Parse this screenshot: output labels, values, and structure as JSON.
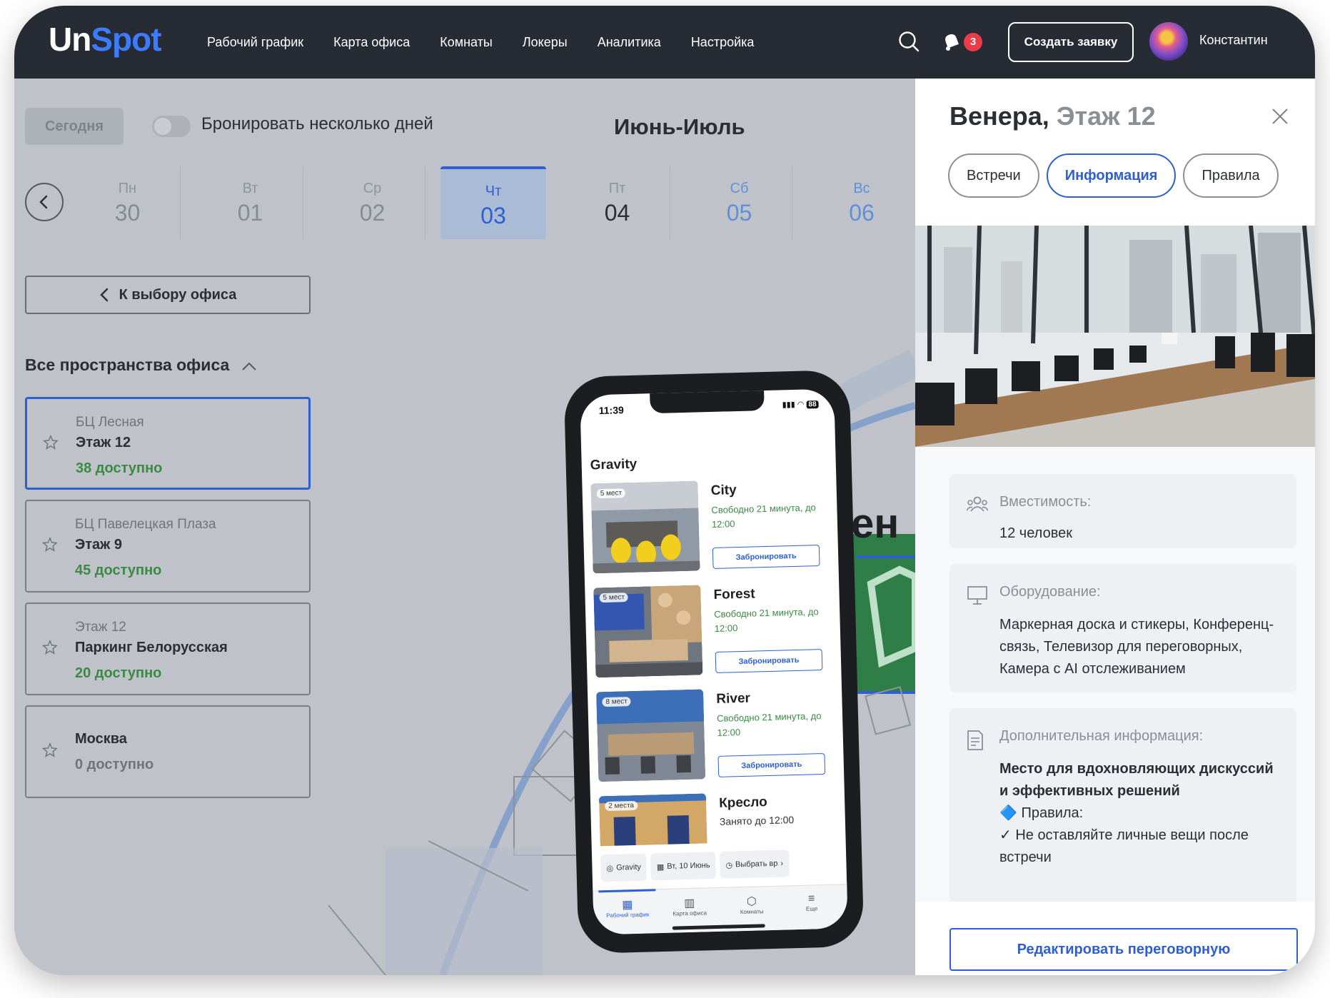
{
  "header": {
    "logo_un": "Un",
    "logo_spot": "Spot",
    "nav": [
      "Рабочий график",
      "Карта офиса",
      "Комнаты",
      "Локеры",
      "Аналитика",
      "Настройка"
    ],
    "notifications_count": "3",
    "create_button": "Создать заявку",
    "user_name": "Константин"
  },
  "calendar": {
    "today_button": "Сегодня",
    "multi_day_label": "Бронировать несколько дней",
    "multi_day_enabled": false,
    "month_label": "Июнь-Июль",
    "days": [
      {
        "name": "Пн",
        "date": "30"
      },
      {
        "name": "Вт",
        "date": "01"
      },
      {
        "name": "Ср",
        "date": "02"
      },
      {
        "name": "Чт",
        "date": "03"
      },
      {
        "name": "Пт",
        "date": "04"
      },
      {
        "name": "Сб",
        "date": "05"
      },
      {
        "name": "Вс",
        "date": "06"
      }
    ],
    "selected_day": "03"
  },
  "sidebar": {
    "back_button": "К выбору офиса",
    "section_title": "Все пространства офиса",
    "offices": [
      {
        "building": "БЦ Лесная",
        "floor": "Этаж 12",
        "available": "38 доступно"
      },
      {
        "building": "БЦ Павелецкая Плаза",
        "floor": "Этаж 9",
        "available": "45 доступно"
      },
      {
        "building": "Этаж 12",
        "floor": "Паркинг Белорусская",
        "available": "20 доступно"
      },
      {
        "building": "",
        "floor": "Москва",
        "available": "0 доступно"
      }
    ]
  },
  "map": {
    "room_label_fragment": "ен"
  },
  "phone": {
    "time": "11:39",
    "battery": "88",
    "section_title": "Gravity",
    "rooms": [
      {
        "name": "City",
        "capacity": "5 мест",
        "status": "Свободно 21 минута, до 12:00",
        "action": "Забронировать"
      },
      {
        "name": "Forest",
        "capacity": "5 мест",
        "status": "Свободно 21 минута, до 12:00",
        "action": "Забронировать"
      },
      {
        "name": "River",
        "capacity": "8 мест",
        "status": "Свободно 21 минута, до 12:00",
        "action": "Забронировать"
      },
      {
        "name": "Кресло",
        "capacity": "2 места",
        "status": "Занято до 12:00",
        "action": ""
      }
    ],
    "filters": [
      "Gravity",
      "Вт, 10 Июнь",
      "Выбрать вр"
    ],
    "tabs": [
      "Рабочий график",
      "Карта офиса",
      "Комнаты",
      "Еще"
    ]
  },
  "panel": {
    "title_room": "Венера,",
    "title_floor": "Этаж 12",
    "tabs": [
      "Встречи",
      "Информация",
      "Правила"
    ],
    "active_tab": "Информация",
    "capacity_label": "Вместимость:",
    "capacity_value": "12 человек",
    "equipment_label": "Оборудование:",
    "equipment_value": "Маркерная доска и стикеры, Конференц-связь, Телевизор для переговорных, Камера с AI отслеживанием",
    "extra_label": "Дополнительная информация:",
    "extra_heading": "Место для вдохновляющих дискуссий и эффективных решений",
    "extra_rules_title": "🔷 Правила:",
    "extra_rule_1": "✓ Не оставляйте личные вещи после встречи",
    "edit_button": "Редактировать переговорную"
  },
  "colors": {
    "accent": "#2d5fd3",
    "topbar": "#272b33",
    "available": "#3b8a43",
    "badge": "#ec3b49"
  }
}
